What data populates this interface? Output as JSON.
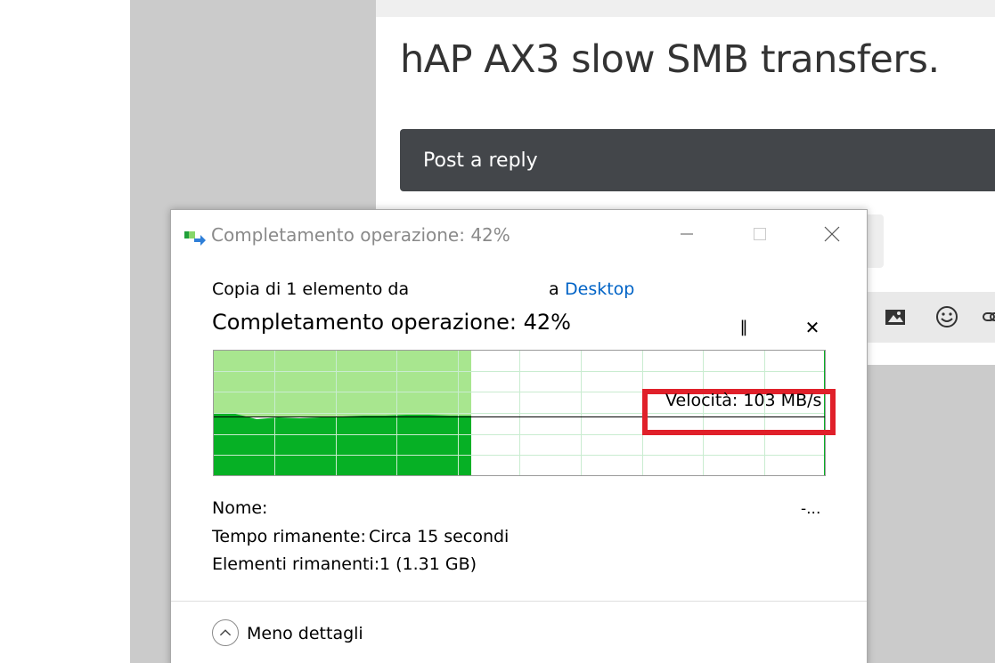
{
  "webpage": {
    "title": "hAP AX3 slow SMB transfers.",
    "reply_button": "Post a reply",
    "toolbar_icons": [
      "image-icon",
      "emoji-icon",
      "link-icon"
    ]
  },
  "dialog": {
    "window_title": "Completamento operazione: 42%",
    "copy_prefix": "Copia di 1 elemento da",
    "copy_to": "a",
    "destination": "Desktop",
    "status": "Completamento operazione: 42%",
    "progress_fraction": 0.42,
    "pause_icon": "pause-icon",
    "cancel_icon": "close-icon",
    "speed": "Velocità: 103 MB/s",
    "name_label": "Nome:",
    "name_value": "-...",
    "time_label": "Tempo rimanente:",
    "time_value": "Circa 15 secondi",
    "items_label": "Elementi rimanenti:",
    "items_value": "1 (1.31 GB)",
    "less_details": "Meno dettagli"
  },
  "colors": {
    "progress_light": "#a8e68f",
    "progress_dark": "#06b025",
    "grid": "#c9ecd0",
    "highlight": "#e0202a",
    "link": "#0063c6"
  }
}
